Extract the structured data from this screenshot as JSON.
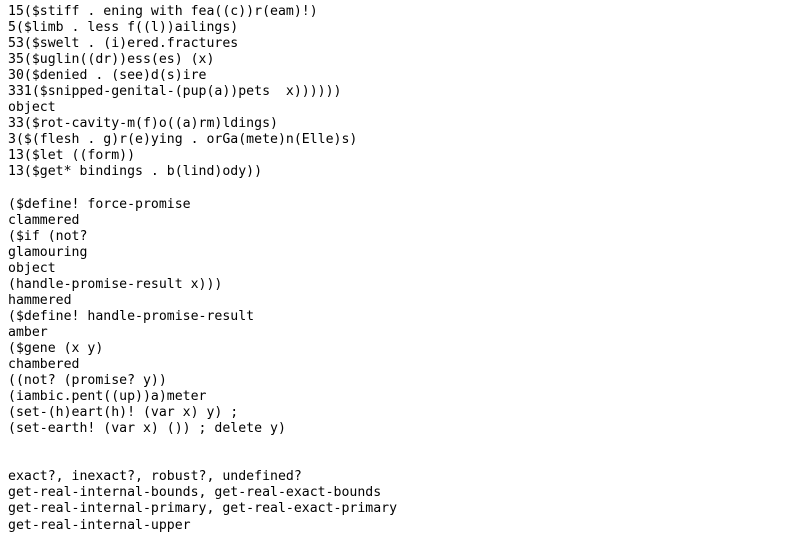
{
  "document": {
    "type": "plain-text-code-listing",
    "text_color": "#000000",
    "background_color": "#ffffff",
    "blocks": [
      {
        "name": "block-nested-parens",
        "lines": [
          "15($stiff . ening with fea((c))r(eam)!)",
          "5($limb . less f((l))ailings)",
          "53($swelt . (i)ered.fractures",
          "35($uglin((dr))ess(es) (x)",
          "30($denied . (see)d(s)ire",
          "331($snipped-genital-(pup(a))pets  x))))))",
          "object",
          "33($rot-cavity-m(f)o((a)rm)ldings)",
          "3($(flesh . g)r(e)ying . orGa(mete)n(Elle)s)",
          "13($let ((form))",
          "13($get* bindings . b(lind)ody))"
        ]
      },
      {
        "name": "block-force-promise",
        "lines": [
          "($define! force-promise",
          "clammered",
          "($if (not?",
          "glamouring",
          "object",
          "(handle-promise-result x)))",
          "hammered",
          "($define! handle-promise-result",
          "amber",
          "($gene (x y)",
          "chambered",
          "((not? (promise? y))",
          "(iambic.pent((up))a)meter",
          "(set-(h)eart(h)! (var x) y) ;",
          "(set-earth! (var x) ()) ; delete y)"
        ]
      },
      {
        "name": "block-predicates-and-bounds",
        "lines": [
          "exact?, inexact?, robust?, undefined?",
          "get-real-internal-bounds, get-real-exact-bounds",
          "get-real-internal-primary, get-real-exact-primary",
          "get-real-internal-upper"
        ]
      }
    ],
    "separators": {
      "after_block_1_blank_lines": 1,
      "after_block_2_blank_lines": 2
    }
  }
}
